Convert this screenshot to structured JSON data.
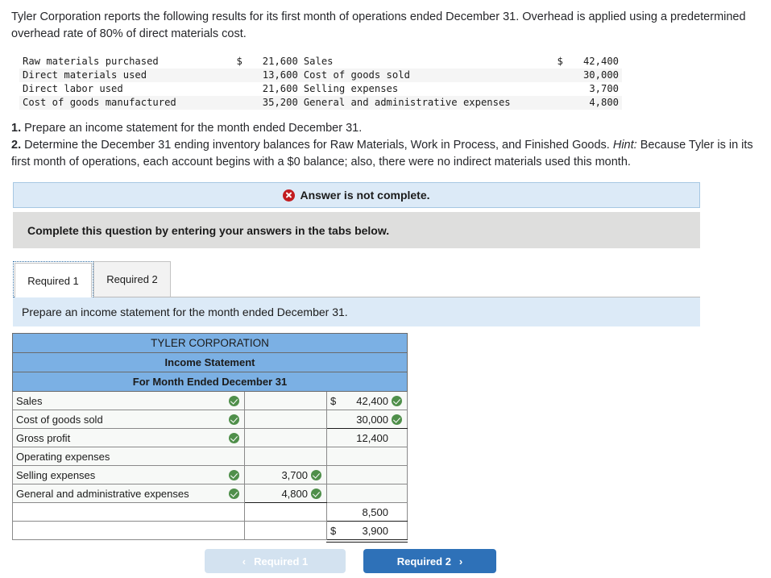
{
  "intro": {
    "paragraph": "Tyler Corporation reports the following results for its first month of operations ended December 31. Overhead is applied using a predetermined overhead rate of 80% of direct materials cost."
  },
  "given_data": {
    "rows": [
      {
        "left_label": "Raw materials purchased",
        "left_currency": "$",
        "left_amount": "21,600",
        "right_label": "Sales",
        "right_currency": "$",
        "right_amount": "42,400"
      },
      {
        "left_label": "Direct materials used",
        "left_currency": "",
        "left_amount": "13,600",
        "right_label": "Cost of goods sold",
        "right_currency": "",
        "right_amount": "30,000"
      },
      {
        "left_label": "Direct labor used",
        "left_currency": "",
        "left_amount": "21,600",
        "right_label": "Selling expenses",
        "right_currency": "",
        "right_amount": "3,700"
      },
      {
        "left_label": "Cost of goods manufactured",
        "left_currency": "",
        "left_amount": "35,200",
        "right_label": "General and administrative expenses",
        "right_currency": "",
        "right_amount": "4,800"
      }
    ]
  },
  "requirements": {
    "item1_number": "1.",
    "item1_text": " Prepare an income statement for the month ended December 31.",
    "item2_number": "2.",
    "item2_text_a": " Determine the December 31 ending inventory balances for Raw Materials, Work in Process, and Finished Goods. ",
    "item2_hint_label": "Hint:",
    "item2_text_b": " Because Tyler is in its first month of operations, each account begins with a $0 balance; also, there were no indirect materials used this month."
  },
  "banner": {
    "icon": "error-x-icon",
    "text": "Answer is not complete.",
    "background": "#dceaf7",
    "icon_color": "#c21c20"
  },
  "instruction_bar": {
    "text": "Complete this question by entering your answers in the tabs below."
  },
  "tabs": [
    {
      "label": "Required 1",
      "active": true
    },
    {
      "label": "Required 2",
      "active": false
    }
  ],
  "prompt": {
    "text": "Prepare an income statement for the month ended December 31."
  },
  "income_statement": {
    "header_color": "#7bb0e4",
    "titles": [
      "TYLER CORPORATION",
      "Income Statement",
      "For Month Ended December 31"
    ],
    "rows": [
      {
        "label": "Sales",
        "label_check": true,
        "mid_currency": "",
        "mid_value": "",
        "mid_check": false,
        "right_currency": "$",
        "right_value": "42,400",
        "right_check": true,
        "filled": true
      },
      {
        "label": "Cost of goods sold",
        "label_check": true,
        "mid_currency": "",
        "mid_value": "",
        "mid_check": false,
        "right_currency": "",
        "right_value": "30,000",
        "right_check": true,
        "filled": true
      },
      {
        "label": "Gross profit",
        "label_check": true,
        "mid_currency": "",
        "mid_value": "",
        "mid_check": false,
        "right_currency": "",
        "right_value": "12,400",
        "right_check": false,
        "filled": true
      },
      {
        "label": "Operating expenses",
        "label_check": false,
        "mid_currency": "",
        "mid_value": "",
        "mid_check": false,
        "right_currency": "",
        "right_value": "",
        "right_check": false,
        "filled": true
      },
      {
        "label": "Selling expenses",
        "label_check": true,
        "mid_currency": "",
        "mid_value": "3,700",
        "mid_check": true,
        "right_currency": "",
        "right_value": "",
        "right_check": false,
        "filled": true
      },
      {
        "label": "General and administrative expenses",
        "label_check": true,
        "mid_currency": "",
        "mid_value": "4,800",
        "mid_check": true,
        "right_currency": "",
        "right_value": "",
        "right_check": false,
        "filled": true
      },
      {
        "label": "",
        "label_check": false,
        "mid_currency": "",
        "mid_value": "",
        "mid_check": false,
        "right_currency": "",
        "right_value": "8,500",
        "right_check": false,
        "filled": false
      },
      {
        "label": "",
        "label_check": false,
        "mid_currency": "",
        "mid_value": "",
        "mid_check": false,
        "right_currency": "$",
        "right_value": "3,900",
        "right_check": false,
        "filled": false
      }
    ]
  },
  "footer_nav": {
    "prev_label": "Required 1",
    "prev_chevron": "‹",
    "next_label": "Required 2",
    "next_chevron": "›",
    "next_color": "#2e71b8",
    "prev_color": "#d3e2f0"
  }
}
